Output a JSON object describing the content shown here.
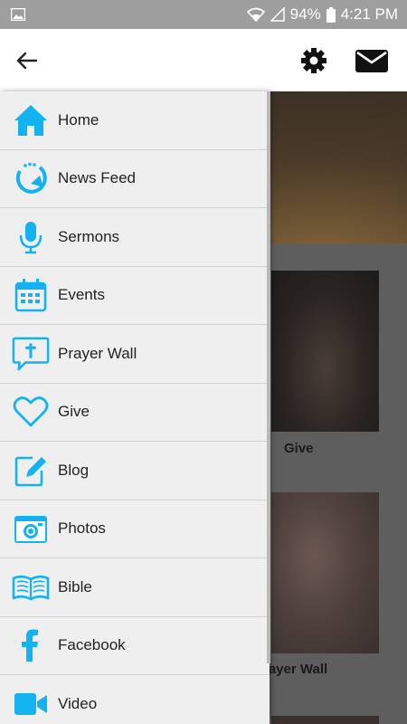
{
  "status_bar": {
    "battery": "94%",
    "time": "4:21 PM"
  },
  "menu": [
    {
      "label": "Home",
      "icon": "home-icon"
    },
    {
      "label": "News Feed",
      "icon": "refresh-icon"
    },
    {
      "label": "Sermons",
      "icon": "microphone-icon"
    },
    {
      "label": "Events",
      "icon": "calendar-icon"
    },
    {
      "label": "Prayer Wall",
      "icon": "cross-chat-icon"
    },
    {
      "label": "Give",
      "icon": "heart-icon"
    },
    {
      "label": "Blog",
      "icon": "edit-icon"
    },
    {
      "label": "Photos",
      "icon": "camera-icon"
    },
    {
      "label": "Bible",
      "icon": "book-icon"
    },
    {
      "label": "Facebook",
      "icon": "facebook-icon"
    },
    {
      "label": "Video",
      "icon": "video-icon"
    }
  ],
  "background": {
    "card1_label": "Give",
    "card2_label": "rayer Wall"
  },
  "colors": {
    "accent": "#12b3f0",
    "drawer": "#efefef"
  }
}
